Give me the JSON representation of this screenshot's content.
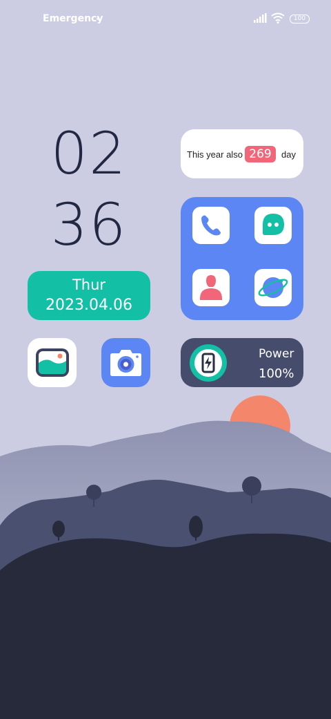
{
  "status_bar": {
    "emergency_label": "Emergency",
    "battery_level": "100"
  },
  "clock": {
    "hours": "02",
    "minutes": "36"
  },
  "date_widget": {
    "day": "Thur",
    "date": "2023.04.06"
  },
  "year_widget": {
    "prefix": "This year also",
    "days": "269",
    "suffix": "day"
  },
  "apps": [
    {
      "icon": "phone-icon"
    },
    {
      "icon": "messages-icon"
    },
    {
      "icon": "contacts-icon"
    },
    {
      "icon": "browser-icon"
    },
    {
      "icon": "gallery-icon"
    },
    {
      "icon": "camera-icon"
    }
  ],
  "power_widget": {
    "label": "Power",
    "value": "100%"
  },
  "colors": {
    "background": "#cccde3",
    "teal": "#13bfa5",
    "blue": "#5d86f5",
    "badge_red": "#f2667a",
    "dark_widget": "#464c6c",
    "sun": "#f4866b"
  }
}
